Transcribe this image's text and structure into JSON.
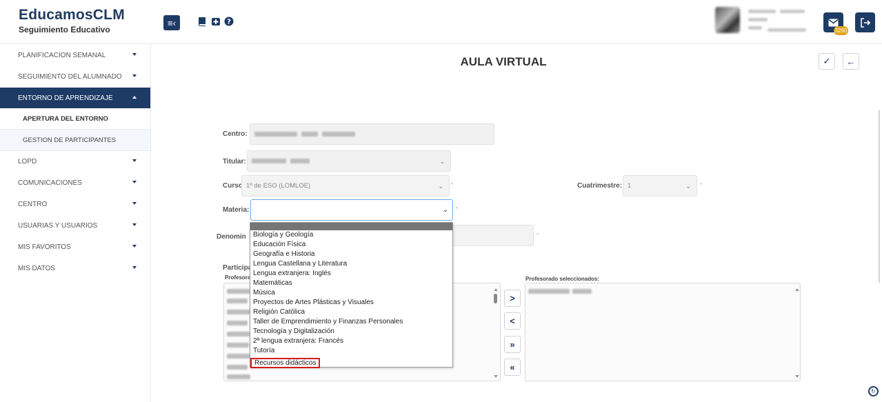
{
  "brand": {
    "title": "EducamosCLM",
    "subtitle": "Seguimiento Educativo"
  },
  "header": {
    "icons": [
      "menu-collapse-icon",
      "book-icon",
      "toolbox-icon",
      "help-icon",
      "mail-icon",
      "logout-icon"
    ],
    "mail_badge": "3260"
  },
  "sidebar": {
    "items": [
      {
        "label": "PLANIFICACION SEMANAL"
      },
      {
        "label": "SEGUIMIENTO DEL ALUMNADO"
      },
      {
        "label": "ENTORNO DE APRENDIZAJE"
      },
      {
        "label": "LOPD"
      },
      {
        "label": "COMUNICACIONES"
      },
      {
        "label": "CENTRO"
      },
      {
        "label": "USUARIAS Y USUARIOS"
      },
      {
        "label": "MIS FAVORITOS"
      },
      {
        "label": "MIS DATOS"
      }
    ],
    "subitems": [
      {
        "label": "APERTURA DEL ENTORNO"
      },
      {
        "label": "GESTION DE PARTICIPANTES"
      }
    ]
  },
  "main": {
    "title": "AULA VIRTUAL",
    "labels": {
      "centro": "Centro:",
      "titular": "Titular:",
      "curso": "Curso:",
      "cuatrimestre": "Cuatrimestre:",
      "materia": "Materia:",
      "denominacion": "Denomin",
      "participantes": "Participa",
      "profesorado": "Profesora",
      "profesorado_seleccionados": "Profesorado seleccionados:"
    },
    "values": {
      "curso": "1º de ESO (LOMLOE)",
      "cuatrimestre": "1"
    },
    "required_mark": "*",
    "move_buttons": [
      ">",
      "<",
      "»",
      "«"
    ],
    "actions": {
      "confirm": "✓",
      "back": "←"
    }
  },
  "dropdown": {
    "options": [
      "Biología y Geología",
      "Educación Física",
      "Geografía e Historia",
      "Lengua Castellana y Literatura",
      "Lengua extranjera: Inglés",
      "Matemáticas",
      "Música",
      "Proyectos de Artes Plásticas y Visuales",
      "Religión Católica",
      "Taller de Emprendimiento y Finanzas Personales",
      "Tecnología y Digitalización",
      "2ª lengua extranjera: Francés",
      "Tutoría",
      "Recursos didácticos"
    ],
    "highlighted": "Recursos didácticos"
  },
  "colors": {
    "primary": "#1e3b66",
    "badge": "#e0a21c",
    "highlight_box": "#d21c1c",
    "focus": "#6ca8e8"
  }
}
